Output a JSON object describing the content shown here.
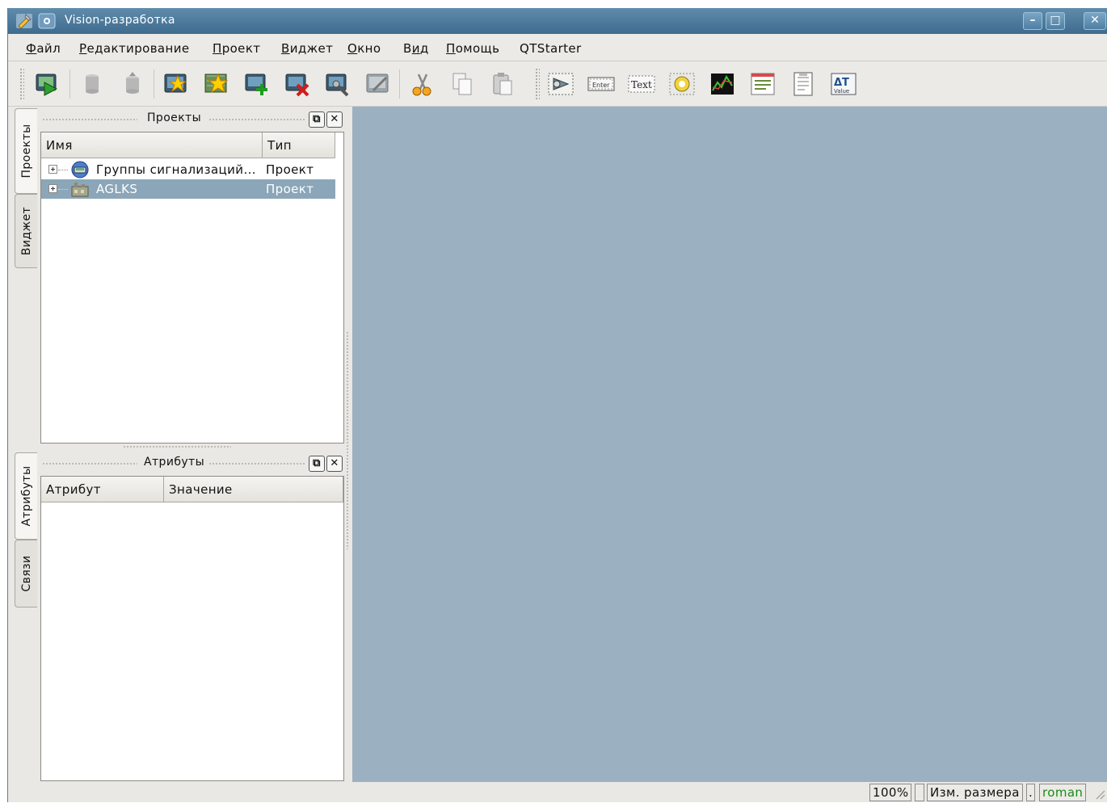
{
  "window": {
    "title": "Vision-разработка"
  },
  "menu": {
    "items": [
      {
        "label": "Файл",
        "accel": 0
      },
      {
        "label": "Редактирование",
        "accel": 0
      },
      {
        "label": "Проект",
        "accel": 0
      },
      {
        "label": "Виджет",
        "accel": 0
      },
      {
        "label": "Окно",
        "accel": 0
      },
      {
        "label": "Вид",
        "accel": 1
      },
      {
        "label": "Помощь",
        "accel": 0
      },
      {
        "label": "QTStarter",
        "accel": -1
      }
    ]
  },
  "toolbar": {
    "widget_text_label": "Text",
    "widget_enter_label": "Enter",
    "value_label": "Value",
    "value_symbol": "ΔT"
  },
  "side_tabs": {
    "projects": "Проекты",
    "widget": "Виджет",
    "attributes": "Атрибуты",
    "links": "Связи"
  },
  "projects_dock": {
    "title": "Проекты",
    "columns": [
      "Имя",
      "Тип"
    ],
    "rows": [
      {
        "name": "Группы сигнализаций...",
        "type": "Проект",
        "selected": false
      },
      {
        "name": "AGLKS",
        "type": "Проект",
        "selected": true
      }
    ]
  },
  "attributes_dock": {
    "title": "Атрибуты",
    "columns": [
      "Атрибут",
      "Значение"
    ]
  },
  "statusbar": {
    "zoom": "100%",
    "mode": "Изм. размера",
    "dot": ".",
    "user": "roman"
  },
  "colors": {
    "titlebar": "#4f7c9d",
    "workspace": "#9bb1c1",
    "selection": "#8ba6b8",
    "user": "#1a8a1a"
  }
}
